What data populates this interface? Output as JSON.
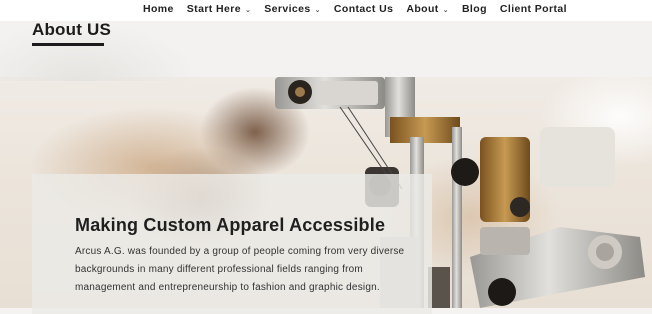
{
  "nav": {
    "items": [
      {
        "label": "Home",
        "dropdown": false
      },
      {
        "label": "Start Here",
        "dropdown": true
      },
      {
        "label": "Services",
        "dropdown": true
      },
      {
        "label": "Contact Us",
        "dropdown": false
      },
      {
        "label": "About",
        "dropdown": true
      },
      {
        "label": "Blog",
        "dropdown": false
      },
      {
        "label": "Client Portal",
        "dropdown": false
      }
    ]
  },
  "page": {
    "title": "About US"
  },
  "hero": {
    "image": "sewing-machine-photo",
    "heading": "Making Custom Apparel Accessible",
    "body": "Arcus A.G. was founded by a group of people coming from very diverse backgrounds in many different professional fields ranging from management and entrepreneurship to fashion and graphic design."
  },
  "colors": {
    "nav_bg": "#ffffff",
    "text": "#1c1c1c",
    "page_bg": "#f3f2f0",
    "brass": "#b8873f"
  }
}
